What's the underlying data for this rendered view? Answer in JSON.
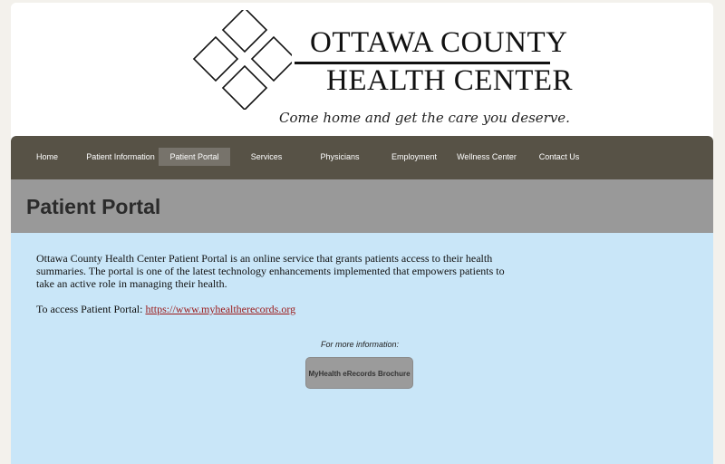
{
  "logo": {
    "line1": "OTTAWA COUNTY",
    "line2": "HEALTH CENTER",
    "tagline": "Come home and get the care you deserve."
  },
  "nav": {
    "items": [
      {
        "label": "Home"
      },
      {
        "label": "Patient Information"
      },
      {
        "label": "Patient Portal",
        "active": true
      },
      {
        "label": "Services"
      },
      {
        "label": "Physicians"
      },
      {
        "label": "Employment"
      },
      {
        "label": "Wellness Center"
      },
      {
        "label": "Contact Us"
      }
    ]
  },
  "page": {
    "title": "Patient Portal",
    "intro": "Ottawa County Health Center Patient Portal is an online service that grants patients access to their health summaries.  The portal is one of the latest technology enhancements implemented that empowers patients to take an active role in managing their health.",
    "access_label": "To access Patient Portal: ",
    "access_link": "https://www.myhealtherecords.org",
    "more_info": "For more information:",
    "brochure_button": "MyHealth eRecords Brochure"
  },
  "colors": {
    "nav_bg": "#575246",
    "nav_active": "#77736b",
    "title_band": "#999999",
    "content_bg": "#c9e6f8",
    "link": "#9b1a1a"
  }
}
